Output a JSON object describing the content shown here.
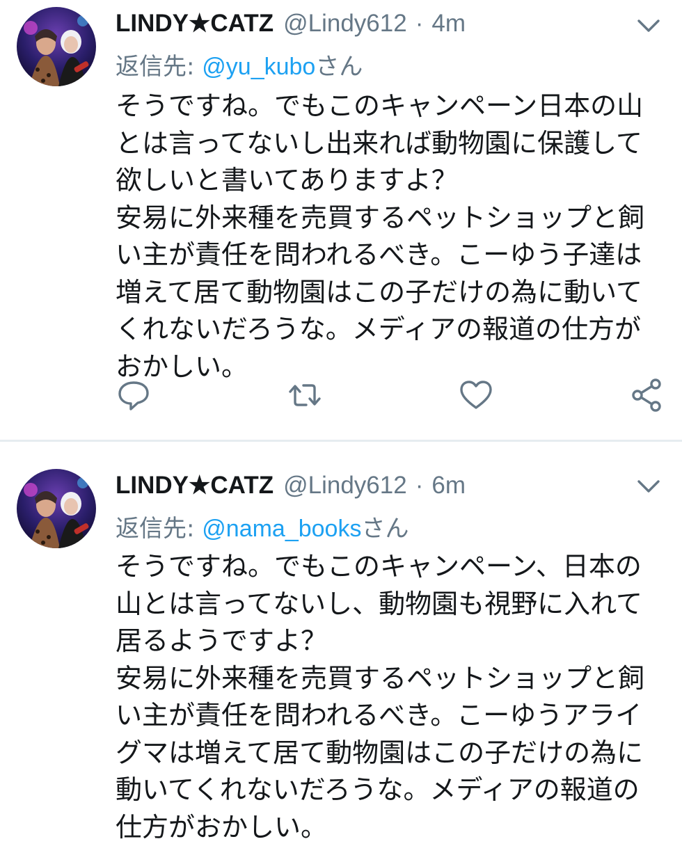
{
  "tweets": [
    {
      "display_name": "LINDY★CATZ",
      "handle": "@Lindy612",
      "separator": "·",
      "time": "4m",
      "reply_prefix": "返信先: ",
      "reply_to": "@yu_kubo",
      "reply_suffix": "さん",
      "lines": [
        "そうですね。でもこのキャンペーン日本の山",
        "とは言ってないし出来れば動物園に保護して",
        "欲しいと書いてありますよ？",
        "安易に外来種を売買するペットショップと飼",
        "い主が責任を問われるべき。こーゆう子達は",
        "増えて居て動物園はこの子だけの為に動いて",
        "くれないだろうな。メディアの報道の仕方が",
        "おかしい。"
      ],
      "actions": [
        "reply-icon",
        "retweet-icon",
        "like-icon",
        "share-icon"
      ]
    },
    {
      "display_name": "LINDY★CATZ",
      "handle": "@Lindy612",
      "separator": "·",
      "time": "6m",
      "reply_prefix": "返信先: ",
      "reply_to": "@nama_books",
      "reply_suffix": "さん",
      "lines": [
        "そうですね。でもこのキャンペーン、日本の",
        "山とは言ってないし、動物園も視野に入れて",
        "居るようですよ？",
        "安易に外来種を売買するペットショップと飼",
        "い主が責任を問われるべき。こーゆうアライ",
        "グマは増えて居て動物園はこの子だけの為に",
        "動いてくれないだろうな。メディアの報道の",
        "仕方がおかしい。"
      ]
    }
  ],
  "colors": {
    "text": "#14171a",
    "secondary": "#657786",
    "link": "#1da1f2",
    "divider": "#e6ecf0"
  }
}
